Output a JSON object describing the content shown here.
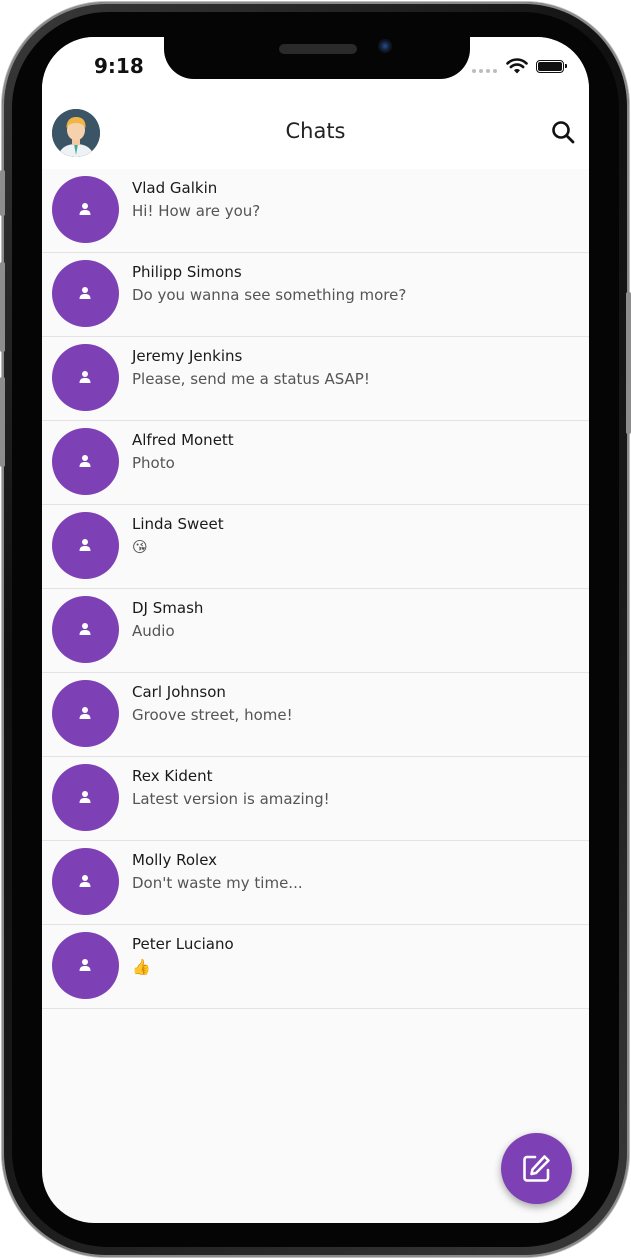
{
  "status_bar": {
    "time": "9:18"
  },
  "app_bar": {
    "title": "Chats",
    "profile_icon": "user-avatar-icon",
    "search_icon": "search-icon"
  },
  "colors": {
    "accent": "#7e40b5",
    "background": "#fafafa",
    "divider": "#e3e3e3"
  },
  "chats": [
    {
      "name": "Vlad Galkin",
      "message": "Hi! How are you?"
    },
    {
      "name": "Philipp Simons",
      "message": "Do you wanna see something more?"
    },
    {
      "name": "Jeremy Jenkins",
      "message": "Please, send me a status ASAP!"
    },
    {
      "name": "Alfred Monett",
      "message": "Photo"
    },
    {
      "name": "Linda Sweet",
      "message": "😘"
    },
    {
      "name": "DJ Smash",
      "message": "Audio"
    },
    {
      "name": "Carl Johnson",
      "message": "Groove street, home!"
    },
    {
      "name": "Rex Kident",
      "message": "Latest version is amazing!"
    },
    {
      "name": "Molly Rolex",
      "message": "Don't waste my time..."
    },
    {
      "name": "Peter Luciano",
      "message": "👍"
    }
  ],
  "fab": {
    "icon": "edit-icon"
  }
}
